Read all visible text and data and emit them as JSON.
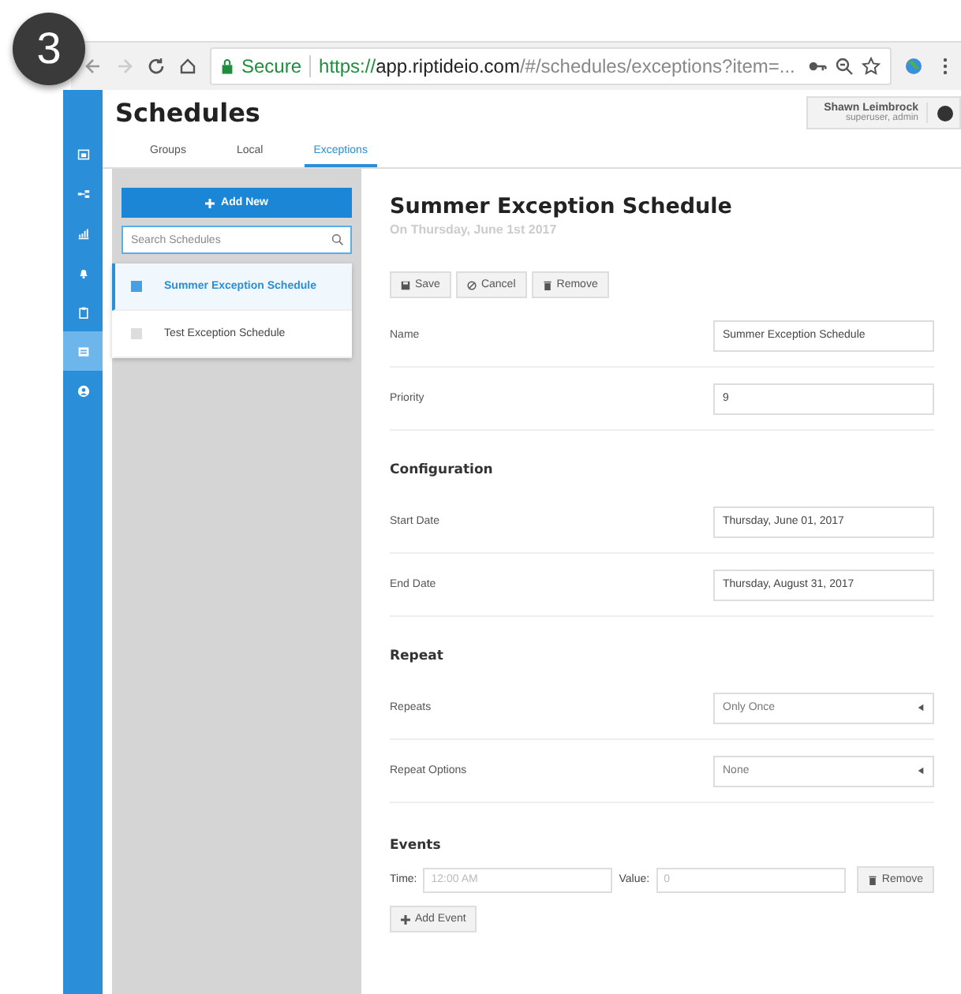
{
  "step_badge": "3",
  "browser": {
    "secure_label": "Secure",
    "url": {
      "scheme": "https://",
      "host": "app.riptideio.com",
      "path": "/#/schedules/exceptions?item=..."
    }
  },
  "nav": [
    {
      "kind": "calendar",
      "selected": false
    },
    {
      "kind": "network",
      "selected": false
    },
    {
      "kind": "chart",
      "selected": false
    },
    {
      "kind": "bell",
      "selected": false
    },
    {
      "kind": "clipboard",
      "selected": false
    },
    {
      "kind": "list",
      "selected": true
    },
    {
      "kind": "user",
      "selected": false
    }
  ],
  "page": {
    "title": "Schedules",
    "user": {
      "name": "Shawn Leimbrock",
      "roles": "superuser, admin"
    }
  },
  "tabs": [
    {
      "label": "Groups",
      "selected": false
    },
    {
      "label": "Local",
      "selected": false
    },
    {
      "label": "Exceptions",
      "selected": true
    }
  ],
  "schedule_list": {
    "add_button": "Add New",
    "search": {
      "placeholder": "Search Schedules"
    },
    "items": [
      {
        "label": "Summer Exception Schedule",
        "selected": true
      },
      {
        "label": "Test Exception Schedule",
        "selected": false
      }
    ]
  },
  "detail": {
    "title": "Summer Exception Schedule",
    "subtitle": "On Thursday, June 1st 2017",
    "actions": [
      {
        "label": "Save",
        "kind": "save"
      },
      {
        "label": "Cancel",
        "kind": "cancel"
      },
      {
        "label": "Remove",
        "kind": "remove"
      }
    ],
    "sections": [
      {
        "rows": [
          {
            "label": "Name",
            "kind": "text",
            "value": "Summer Exception Schedule"
          },
          {
            "label": "Priority",
            "kind": "text",
            "value": "9"
          }
        ]
      },
      {
        "heading": "Configuration",
        "rows": [
          {
            "label": "Start Date",
            "kind": "text",
            "value": "Thursday, June 01, 2017"
          },
          {
            "label": "End Date",
            "kind": "text",
            "value": "Thursday, August 31, 2017"
          }
        ]
      },
      {
        "heading": "Repeat",
        "rows": [
          {
            "label": "Repeats",
            "kind": "select",
            "value": "Only Once"
          },
          {
            "label": "Repeat Options",
            "kind": "select",
            "value": "None"
          }
        ]
      }
    ],
    "events": {
      "heading": "Events",
      "rows": [
        {
          "time_label": "Time:",
          "time_placeholder": "12:00 AM",
          "value_label": "Value:",
          "value_placeholder": "0",
          "remove_button": "Remove"
        }
      ],
      "add_button": "Add Event"
    }
  }
}
